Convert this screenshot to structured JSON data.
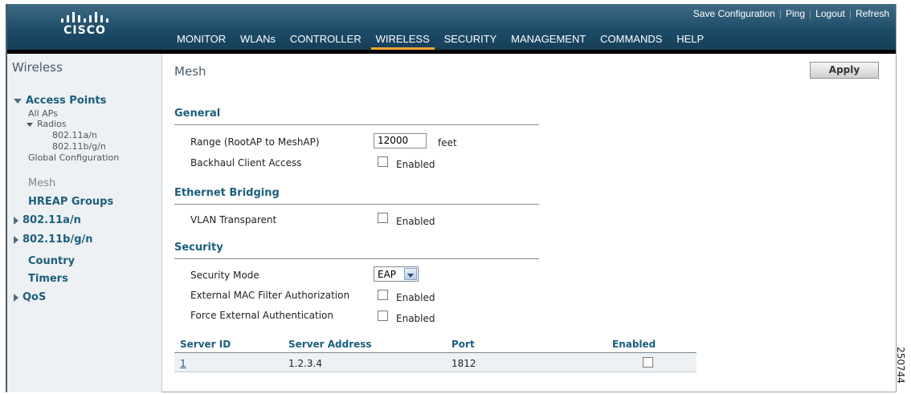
{
  "brand": {
    "logo_text": "CISCO"
  },
  "utility_links": [
    "Save Configuration",
    "Ping",
    "Logout",
    "Refresh"
  ],
  "nav_tabs": [
    {
      "label": "MONITOR",
      "active": false
    },
    {
      "label": "WLANs",
      "active": false
    },
    {
      "label": "CONTROLLER",
      "active": false
    },
    {
      "label": "WIRELESS",
      "active": true
    },
    {
      "label": "SECURITY",
      "active": false
    },
    {
      "label": "MANAGEMENT",
      "active": false
    },
    {
      "label": "COMMANDS",
      "active": false
    },
    {
      "label": "HELP",
      "active": false
    }
  ],
  "sidebar": {
    "title": "Wireless",
    "access_points": "Access Points",
    "all_aps": "All APs",
    "radios": "Radios",
    "radio_a": "802.11a/n",
    "radio_bg": "802.11b/g/n",
    "global_config": "Global Configuration",
    "mesh": "Mesh",
    "hreap": "HREAP Groups",
    "dot11an": "802.11a/n",
    "dot11bgn": "802.11b/g/n",
    "country": "Country",
    "timers": "Timers",
    "qos": "QoS"
  },
  "page": {
    "title": "Mesh",
    "apply_label": "Apply"
  },
  "general": {
    "title": "General",
    "range_label": "Range (RootAP to MeshAP)",
    "range_value": "12000",
    "range_unit": "feet",
    "backhaul_label": "Backhaul Client Access",
    "backhaul_checked": false,
    "enabled_label": "Enabled"
  },
  "ethernet": {
    "title": "Ethernet Bridging",
    "vlan_label": "VLAN Transparent",
    "vlan_checked": false,
    "enabled_label": "Enabled"
  },
  "security": {
    "title": "Security",
    "mode_label": "Security Mode",
    "mode_value": "EAP",
    "mac_label": "External MAC Filter Authorization",
    "mac_checked": false,
    "force_label": "Force External Authentication",
    "force_checked": false,
    "enabled_label": "Enabled"
  },
  "server_table": {
    "headers": [
      "Server ID",
      "Server Address",
      "Port",
      "Enabled"
    ],
    "rows": [
      {
        "id": "1",
        "address": "1.2.3.4",
        "port": "1812",
        "enabled": false
      }
    ]
  },
  "figure_id": "250744"
}
